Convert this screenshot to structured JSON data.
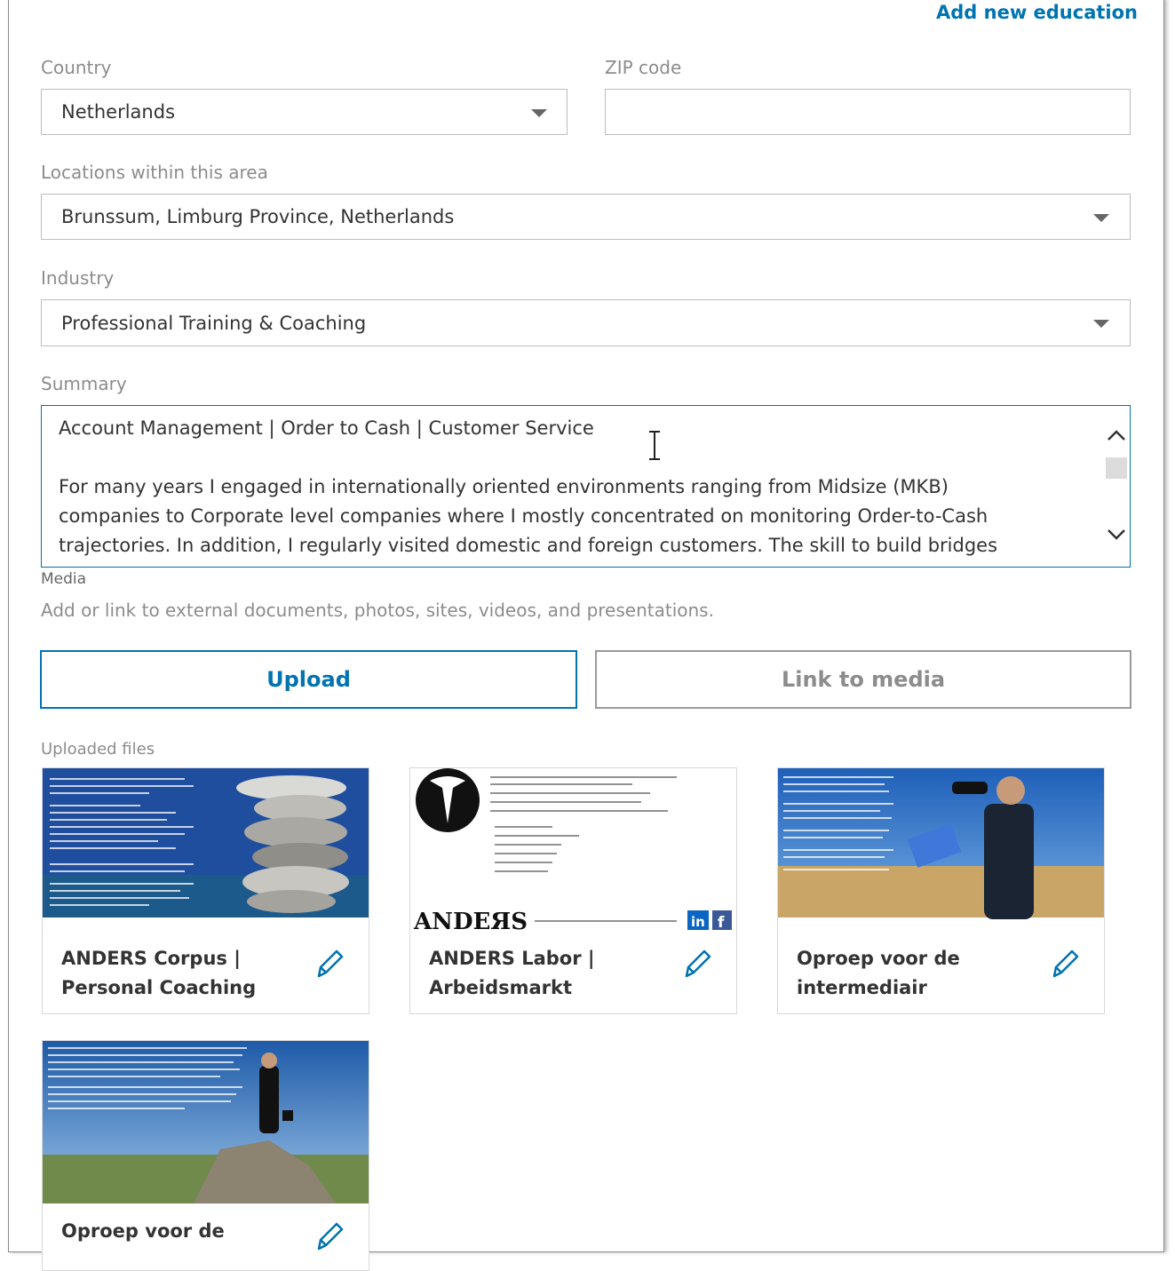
{
  "top_link": "Add new education",
  "country": {
    "label": "Country",
    "value": "Netherlands"
  },
  "zip": {
    "label": "ZIP code",
    "value": ""
  },
  "locations": {
    "label": "Locations within this area",
    "value": "Brunssum, Limburg Province, Netherlands"
  },
  "industry": {
    "label": "Industry",
    "value": "Professional Training & Coaching"
  },
  "summary": {
    "label": "Summary",
    "lines": [
      "Account Management | Order to Cash | Customer Service",
      "For many years I engaged in internationally oriented environments ranging from Midsize (MKB)",
      "companies to Corporate level companies where I mostly concentrated on monitoring  Order-to-Cash",
      "trajectories. In addition, I regularly visited domestic and foreign customers. The skill to build bridges"
    ]
  },
  "media": {
    "label": "Media",
    "description": "Add or link to external documents, photos, sites, videos, and presentations.",
    "upload_label": "Upload",
    "link_label": "Link to media",
    "uploaded_label": "Uploaded files"
  },
  "files": [
    {
      "title": "ANDERS Corpus | Personal Coaching"
    },
    {
      "title": "ANDERS Labor | Arbeidsmarkt",
      "logo_text": "ANDERS"
    },
    {
      "title": "Oproep voor de intermediair"
    },
    {
      "title": "Oproep voor de"
    }
  ],
  "colors": {
    "accent": "#0073b1",
    "border": "#bdbdbd",
    "label": "#8c8c8c"
  }
}
